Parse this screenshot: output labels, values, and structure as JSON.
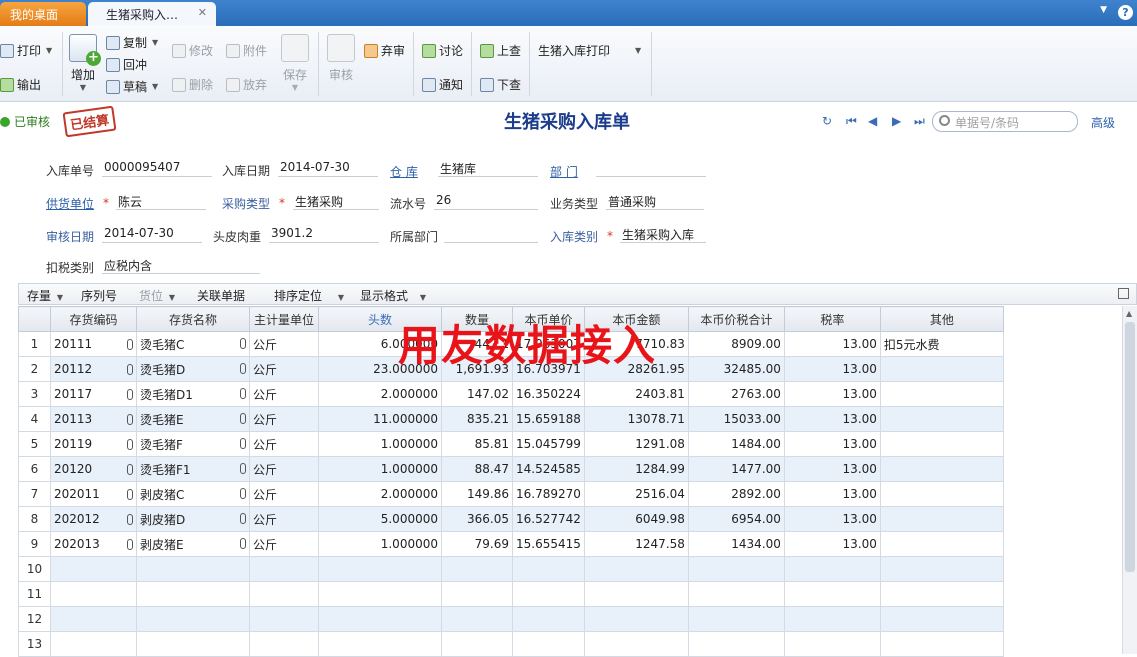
{
  "tabs": {
    "home": "我的桌面",
    "active": "生猪采购入…"
  },
  "toolbar": {
    "print": "打印",
    "export": "输出",
    "add": "增加",
    "copy": "复制",
    "reverse": "回冲",
    "draft": "草稿",
    "modify": "修改",
    "attach": "附件",
    "delete": "删除",
    "abandon": "放弃",
    "save": "保存",
    "audit": "审核",
    "unaudit": "弃审",
    "discuss": "讨论",
    "notify": "通知",
    "prev_query": "上查",
    "next_query": "下查",
    "print_template": "生猪入库打印"
  },
  "titlebar": {
    "status": "已审核",
    "stamp": "已结算",
    "title": "生猪采购入库单",
    "search_placeholder": "单据号/条码",
    "advanced": "高级"
  },
  "header": {
    "receipt_no_label": "入库单号",
    "receipt_no": "0000095407",
    "receipt_date_label": "入库日期",
    "receipt_date": "2014-07-30",
    "warehouse_label": "仓    库",
    "warehouse": "生猪库",
    "dept_label": "部    门",
    "dept": "",
    "supplier_label": "供货单位",
    "supplier": "陈云",
    "purchase_type_label": "采购类型",
    "purchase_type": "生猪采购",
    "serial_label": "流水号",
    "serial": "26",
    "biz_type_label": "业务类型",
    "biz_type": "普通采购",
    "audit_date_label": "审核日期",
    "audit_date": "2014-07-30",
    "carcass_label": "头皮肉重",
    "carcass": "3901.2",
    "belong_dept_label": "所属部门",
    "belong_dept": "",
    "receipt_cat_label": "入库类别",
    "receipt_cat": "生猪采购入库",
    "tax_type_label": "扣税类别",
    "tax_type": "应税内含"
  },
  "gridbar": {
    "stock": "存量",
    "serial": "序列号",
    "location": "货位",
    "linked": "关联单据",
    "sort": "排序定位",
    "format": "显示格式"
  },
  "columns": [
    "存货编码",
    "存货名称",
    "主计量单位",
    "头数",
    "数量",
    "本币单价",
    "本币金额",
    "本币价税合计",
    "税率",
    "其他"
  ],
  "rows": [
    [
      "20111",
      "烫毛猪C",
      "公斤",
      "6.000000",
      "447.1",
      "17.963007",
      "7710.83",
      "8909.00",
      "13.00",
      "扣5元水费"
    ],
    [
      "20112",
      "烫毛猪D",
      "公斤",
      "23.000000",
      "1,691.93",
      "16.703971",
      "28261.95",
      "32485.00",
      "13.00",
      ""
    ],
    [
      "20117",
      "烫毛猪D1",
      "公斤",
      "2.000000",
      "147.02",
      "16.350224",
      "2403.81",
      "2763.00",
      "13.00",
      ""
    ],
    [
      "20113",
      "烫毛猪E",
      "公斤",
      "11.000000",
      "835.21",
      "15.659188",
      "13078.71",
      "15033.00",
      "13.00",
      ""
    ],
    [
      "20119",
      "烫毛猪F",
      "公斤",
      "1.000000",
      "85.81",
      "15.045799",
      "1291.08",
      "1484.00",
      "13.00",
      ""
    ],
    [
      "20120",
      "烫毛猪F1",
      "公斤",
      "1.000000",
      "88.47",
      "14.524585",
      "1284.99",
      "1477.00",
      "13.00",
      ""
    ],
    [
      "202011",
      "剥皮猪C",
      "公斤",
      "2.000000",
      "149.86",
      "16.789270",
      "2516.04",
      "2892.00",
      "13.00",
      ""
    ],
    [
      "202012",
      "剥皮猪D",
      "公斤",
      "5.000000",
      "366.05",
      "16.527742",
      "6049.98",
      "6954.00",
      "13.00",
      ""
    ],
    [
      "202013",
      "剥皮猪E",
      "公斤",
      "1.000000",
      "79.69",
      "15.655415",
      "1247.58",
      "1434.00",
      "13.00",
      ""
    ]
  ],
  "row_numbers": [
    "1",
    "2",
    "3",
    "4",
    "5",
    "6",
    "7",
    "8",
    "9",
    "10",
    "11",
    "12",
    "13"
  ],
  "watermark": "用友数据接入"
}
